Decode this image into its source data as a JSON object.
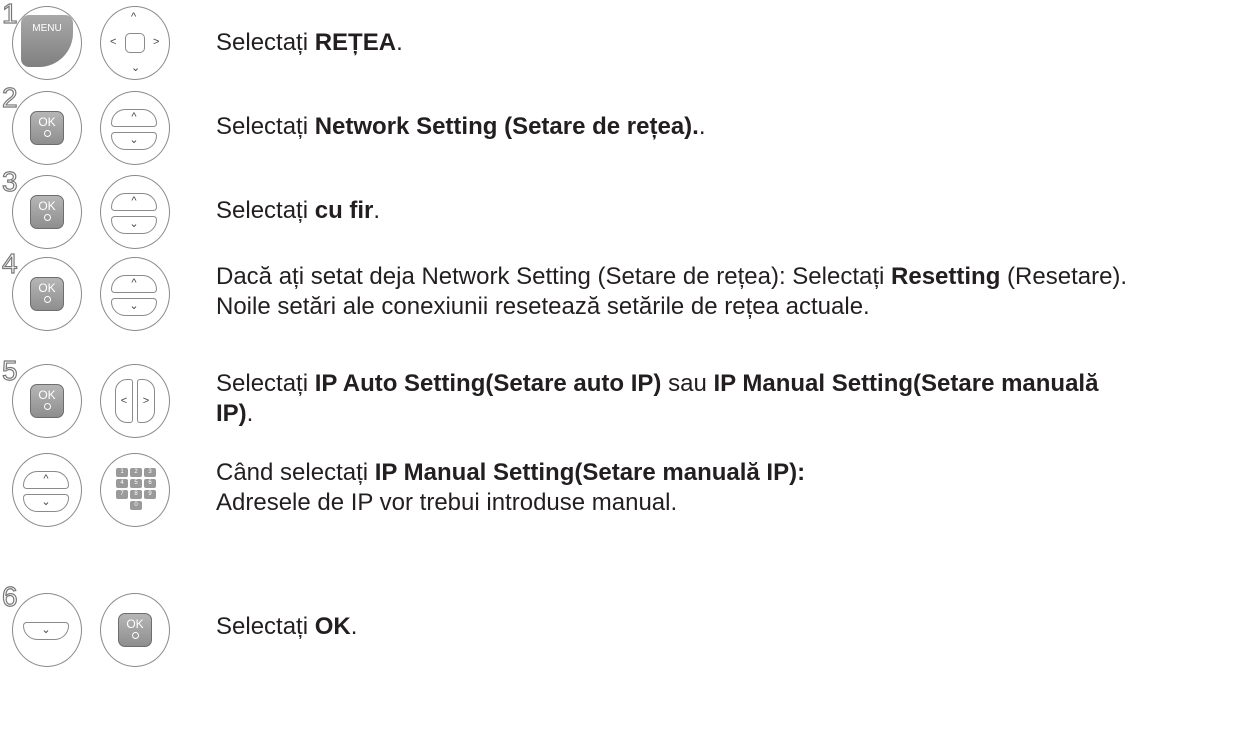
{
  "steps": [
    {
      "num": "1",
      "pre": "Selectați ",
      "bold": "REȚEA",
      "post": "."
    },
    {
      "num": "2",
      "pre": "Selectați ",
      "bold": "Network Setting (Setare de rețea).",
      "post": "."
    },
    {
      "num": "3",
      "pre": "Selectați ",
      "bold": "cu fir",
      "post": "."
    },
    {
      "num": "4",
      "pre": "Dacă ați setat deja Network Setting (Setare de rețea): Selectați ",
      "bold": "Resetting",
      "post": " (Resetare).",
      "line2": "Noile setări ale conexiunii resetează setările de rețea actuale."
    },
    {
      "num": "5",
      "pre": "Selectați ",
      "bold": "IP Auto Setting(Setare auto IP)",
      "mid": " sau ",
      "bold2": "IP Manual Setting(Setare manuală",
      "line2_bold": "IP)",
      "line2_post": "."
    },
    {
      "pre": "Când selectați ",
      "bold": "IP Manual Setting(Setare manuală IP):",
      "line2": "Adresele de IP vor trebui introduse manual."
    },
    {
      "num": "6",
      "pre": "Selectați ",
      "bold": "OK",
      "post": "."
    }
  ],
  "keys": {
    "menu": "MENU",
    "ok": "OK",
    "up_arrow": "^",
    "down_arrow": "⌄",
    "left_arrow": "<",
    "right_arrow": ">",
    "numpad": [
      "1",
      "2",
      "3",
      "4",
      "5",
      "6",
      "7",
      "8",
      "9",
      "0"
    ]
  }
}
